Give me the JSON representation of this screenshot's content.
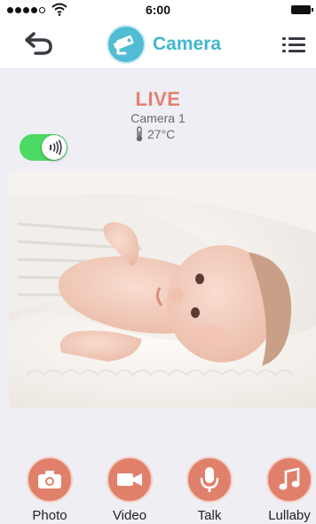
{
  "status_bar": {
    "time": "6:00",
    "signal_icon": "signal-dots-icon",
    "wifi_icon": "wifi-icon",
    "battery_icon": "battery-icon"
  },
  "nav": {
    "title": "Camera",
    "back_icon": "back-arrow-icon",
    "camera_icon": "security-camera-icon",
    "menu_icon": "menu-icon"
  },
  "live": {
    "status": "LIVE",
    "camera_name": "Camera 1",
    "temperature": "27°C",
    "thermometer_icon": "thermometer-icon",
    "sound_toggle_on": true,
    "sound_icon": "sound-waves-icon"
  },
  "video": {
    "feed_icon": "baby-video-feed"
  },
  "actions": [
    {
      "label": "Photo",
      "icon": "camera-icon"
    },
    {
      "label": "Video",
      "icon": "video-camera-icon"
    },
    {
      "label": "Talk",
      "icon": "microphone-icon"
    },
    {
      "label": "Lullaby",
      "icon": "music-note-icon"
    }
  ],
  "colors": {
    "accent": "#42b7cf",
    "live": "#e5806c",
    "action_button": "#e0806b",
    "toggle_on": "#4cd964",
    "background": "#efeef5"
  }
}
